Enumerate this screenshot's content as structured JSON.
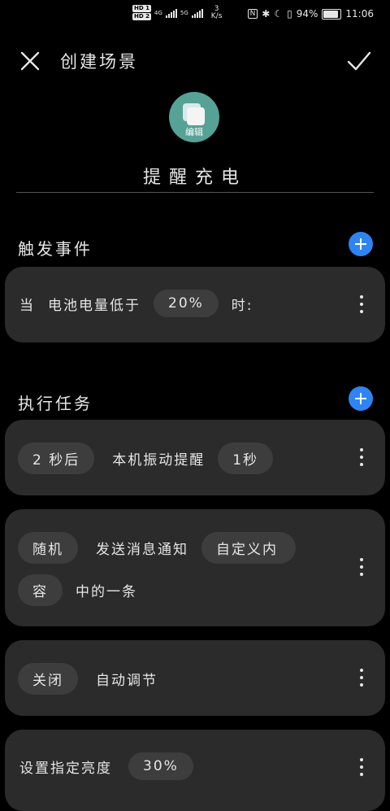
{
  "status": {
    "hd1": "HD 1",
    "hd2": "HD 2",
    "net1": "4G",
    "net2": "5G",
    "speed_value": "3",
    "speed_unit": "K/s",
    "battery": "94%",
    "time": "11:06"
  },
  "header": {
    "title": "创建场景"
  },
  "scene": {
    "edit_label": "编辑",
    "name": "提醒充电"
  },
  "trigger": {
    "section_title": "触发事件",
    "item": {
      "prefix": "当",
      "condition": "电池电量低于",
      "value": "20%",
      "suffix": "时:"
    }
  },
  "tasks": {
    "section_title": "执行任务",
    "items": [
      {
        "delay": "2 秒后",
        "action": "本机振动提醒",
        "duration": "1秒"
      },
      {
        "mode": "随机",
        "action": "发送消息通知",
        "content_part1": "自定义内",
        "content_part2": "容",
        "suffix": "中的一条"
      },
      {
        "state": "关闭",
        "action": "自动调节"
      },
      {
        "action": "设置指定亮度",
        "value": "30%"
      }
    ]
  }
}
